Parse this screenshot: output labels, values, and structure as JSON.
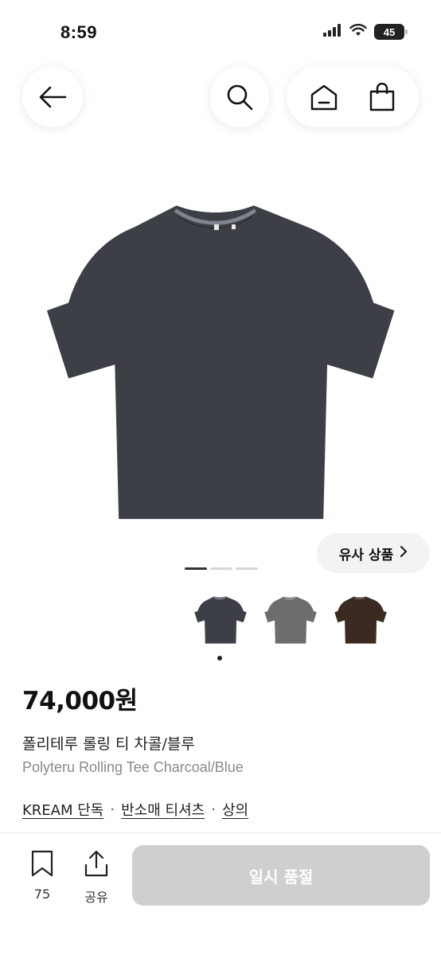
{
  "status_bar": {
    "time": "8:59",
    "battery": "45",
    "icons": [
      "signal-icon",
      "wifi-icon",
      "battery-icon"
    ]
  },
  "nav": {
    "icons": [
      "back-arrow-icon",
      "search-icon",
      "home-icon",
      "shopping-bag-icon"
    ]
  },
  "gallery": {
    "similar_label": "유사 상품",
    "page_count": 3,
    "active_page": 0,
    "thumbnails": [
      {
        "color": "#3c3f45",
        "icon": "tshirt-charcoal"
      },
      {
        "color": "#6e6c6e",
        "icon": "tshirt-gray"
      },
      {
        "color": "#3a2a21",
        "icon": "tshirt-brown"
      }
    ]
  },
  "product": {
    "price": "74,000원",
    "name_ko": "폴리테루 롤링 티 차콜/블루",
    "name_en": "Polyteru Rolling Tee Charcoal/Blue",
    "tags": [
      "KREAM 단독",
      "반소매 티셔츠",
      "상의"
    ],
    "tag_separator": "·"
  },
  "bottom_bar": {
    "bookmark_count": "75",
    "share_label": "공유",
    "soldout_label": "일시 품절"
  },
  "colors": {
    "shirt_main": "#3c3f45",
    "soldout_bg": "#cfcfcf"
  }
}
